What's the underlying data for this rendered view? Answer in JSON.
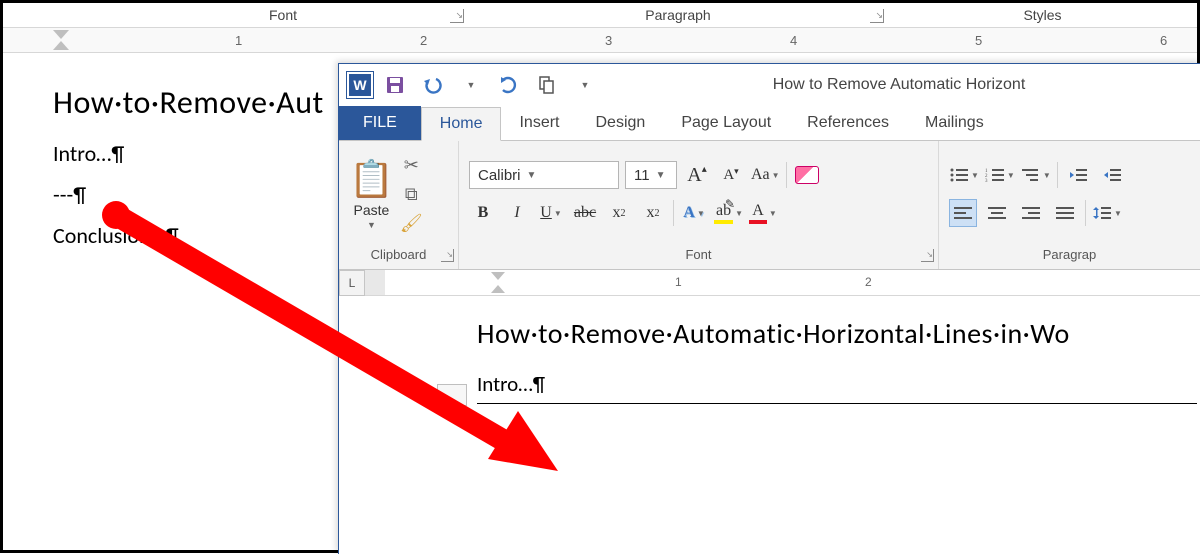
{
  "bg": {
    "group_labels": {
      "font": "Font",
      "paragraph": "Paragraph",
      "styles": "Styles"
    },
    "ruler_ticks": [
      "1",
      "2",
      "3",
      "4",
      "5",
      "6"
    ],
    "doc": {
      "heading": "How·to·Remove·Aut",
      "lines": [
        "Intro…¶",
        "---¶",
        "Conclusion…¶"
      ]
    }
  },
  "fg": {
    "title": "How to Remove Automatic Horizont",
    "qat": {
      "save": "save-icon",
      "undo": "undo-icon",
      "redo": "redo-icon",
      "touch": "touch-icon"
    },
    "tabs": {
      "file": "FILE",
      "home": "Home",
      "insert": "Insert",
      "design": "Design",
      "pagelayout": "Page Layout",
      "references": "References",
      "mailings": "Mailings"
    },
    "clipboard": {
      "paste": "Paste",
      "label": "Clipboard"
    },
    "font": {
      "name": "Calibri",
      "size": "11",
      "label": "Font",
      "growA": "A",
      "shrinkA": "A",
      "caseAa": "Aa",
      "bold": "B",
      "italic": "I",
      "underline": "U",
      "strike": "abc",
      "sub": "x",
      "subn": "2",
      "sup": "x",
      "supn": "2",
      "texteffect": "A",
      "highlight": "ab",
      "fontcolor": "A"
    },
    "paragraph": {
      "label": "Paragrap"
    },
    "ruler_ticks": [
      "1",
      "2"
    ],
    "tabwell": "L",
    "doc": {
      "heading": "How·to·Remove·Automatic·Horizontal·Lines·in·Wo",
      "intro": "Intro…¶",
      "blank": "¶"
    }
  }
}
